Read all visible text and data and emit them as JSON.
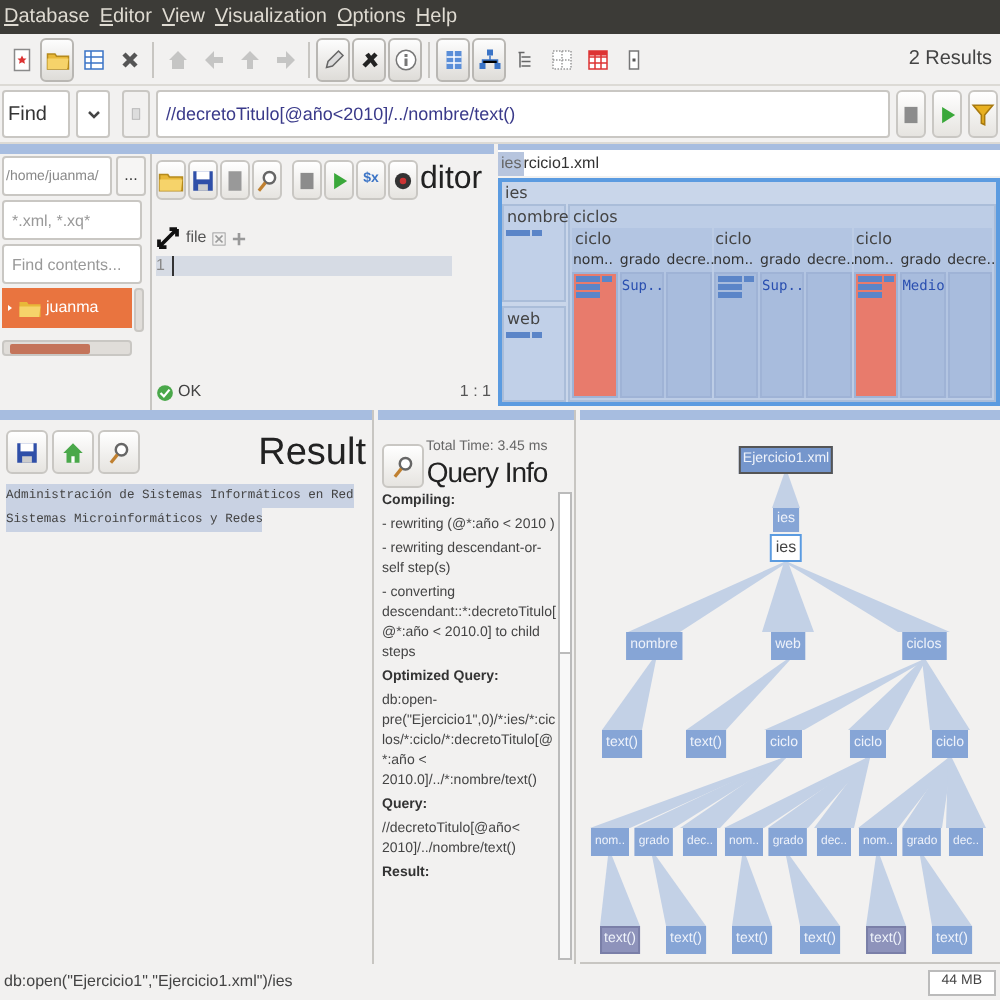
{
  "menu": [
    "Database",
    "Editor",
    "View",
    "Visualization",
    "Options",
    "Help"
  ],
  "toolbar": {
    "groups": [
      [
        {
          "pressed": false,
          "disabled": false
        },
        {
          "pressed": true,
          "disabled": false
        },
        {
          "pressed": false,
          "disabled": false
        },
        {
          "pressed": false,
          "disabled": false
        }
      ],
      [
        {
          "pressed": false,
          "disabled": true
        },
        {
          "pressed": false,
          "disabled": true
        },
        {
          "pressed": false,
          "disabled": true
        },
        {
          "pressed": false,
          "disabled": true
        }
      ],
      [
        {
          "pressed": true,
          "disabled": false
        },
        {
          "pressed": true,
          "disabled": false
        },
        {
          "pressed": true,
          "disabled": false
        }
      ],
      [
        {
          "pressed": true,
          "disabled": false
        },
        {
          "pressed": true,
          "disabled": false
        },
        {
          "pressed": false,
          "disabled": false
        },
        {
          "pressed": false,
          "disabled": false
        },
        {
          "pressed": false,
          "disabled": false
        },
        {
          "pressed": false,
          "disabled": false
        }
      ]
    ],
    "results": "2 Results"
  },
  "find": {
    "mode": "Find",
    "query": "//decretoTitulo[@año<2010]/../nombre/text()"
  },
  "file_browser": {
    "path": "/home/juanma/",
    "filter": "*.xml, *.xq*",
    "search_placeholder": "Find contents...",
    "browse_button": "...",
    "items": [
      {
        "label": "juanma",
        "selected": true
      }
    ]
  },
  "editor": {
    "title": "ditor",
    "xpath_button": "$x",
    "tab": "file",
    "line_number": "1",
    "status": "OK",
    "position": "1 : 1"
  },
  "map": {
    "tooltip": "ies",
    "title": "rcicio1.xml",
    "root": {
      "label": "ies",
      "children": [
        {
          "label": "nombre"
        },
        {
          "label": "web"
        },
        {
          "label": "ciclos",
          "children": [
            {
              "label": "ciclo",
              "children": [
                {
                  "label": "nom..",
                  "selected": true
                },
                {
                  "label": "grado",
                  "value": "Sup..",
                  "selected": false
                },
                {
                  "label": "decre..",
                  "selected": false
                }
              ]
            },
            {
              "label": "ciclo",
              "children": [
                {
                  "label": "nom..",
                  "selected": false
                },
                {
                  "label": "grado",
                  "value": "Sup..",
                  "selected": false
                },
                {
                  "label": "decre..",
                  "selected": false
                }
              ]
            },
            {
              "label": "ciclo",
              "children": [
                {
                  "label": "nom..",
                  "selected": true
                },
                {
                  "label": "grado",
                  "value": "Medio",
                  "selected": false
                },
                {
                  "label": "decre..",
                  "selected": false
                }
              ]
            }
          ]
        }
      ]
    }
  },
  "result": {
    "title": "Result",
    "lines": [
      {
        "text": "Administración de Sistemas Informáticos en Red",
        "selected": true
      },
      {
        "text": "Sistemas Microinformáticos y Redes",
        "selected": true
      }
    ]
  },
  "query_info": {
    "title": "Query Info",
    "total_time": "Total Time: 3.45 ms",
    "sections": [
      {
        "heading": "Compiling:",
        "lines": [
          "- rewriting (@*:año < 2010 )",
          "- rewriting descendant-or-self step(s)",
          "- converting descendant::*:decretoTitulo[@*:año < 2010.0] to child steps"
        ]
      },
      {
        "heading": "Optimized Query:",
        "lines": [
          "db:open-pre(\"Ejercicio1\",0)/*:ies/*:ciclos/*:ciclo/*:decretoTitulo[@*:año < 2010.0]/../*:nombre/text()"
        ]
      },
      {
        "heading": "Query:",
        "lines": [
          "//decretoTitulo[@año< 2010]/../nombre/text()"
        ]
      },
      {
        "heading": "Result:"
      }
    ]
  },
  "tree": {
    "label": "Ejercicio1.xml",
    "selected": true,
    "children": [
      {
        "label": "ies",
        "tooltip": "ies",
        "selected": false,
        "children": [
          {
            "label": "nombre",
            "selected": false,
            "children": [
              {
                "label": "text()",
                "selected": false
              }
            ]
          },
          {
            "label": "web",
            "selected": false,
            "children": [
              {
                "label": "text()",
                "selected": false
              }
            ]
          },
          {
            "label": "ciclos",
            "selected": false,
            "children": [
              {
                "label": "ciclo",
                "selected": false,
                "children": [
                  {
                    "label": "nom..",
                    "selected": false,
                    "children": [
                      {
                        "label": "text()",
                        "selected": true
                      }
                    ]
                  },
                  {
                    "label": "grado",
                    "selected": false,
                    "children": [
                      {
                        "label": "text()",
                        "selected": false
                      }
                    ]
                  },
                  {
                    "label": "dec..",
                    "selected": false
                  }
                ]
              },
              {
                "label": "ciclo",
                "selected": false,
                "children": [
                  {
                    "label": "nom..",
                    "selected": false,
                    "children": [
                      {
                        "label": "text()",
                        "selected": false
                      }
                    ]
                  },
                  {
                    "label": "grado",
                    "selected": false,
                    "children": [
                      {
                        "label": "text()",
                        "selected": false
                      }
                    ]
                  },
                  {
                    "label": "dec..",
                    "selected": false
                  }
                ]
              },
              {
                "label": "ciclo",
                "selected": false,
                "children": [
                  {
                    "label": "nom..",
                    "selected": false,
                    "children": [
                      {
                        "label": "text()",
                        "selected": true
                      }
                    ]
                  },
                  {
                    "label": "grado",
                    "selected": false,
                    "children": [
                      {
                        "label": "text()",
                        "selected": false
                      }
                    ]
                  },
                  {
                    "label": "dec..",
                    "selected": false
                  }
                ]
              }
            ]
          }
        ]
      }
    ]
  },
  "status_bar": {
    "path": "db:open(\"Ejercicio1\",\"Ejercicio1.xml\")/ies",
    "memory": "44 MB"
  }
}
